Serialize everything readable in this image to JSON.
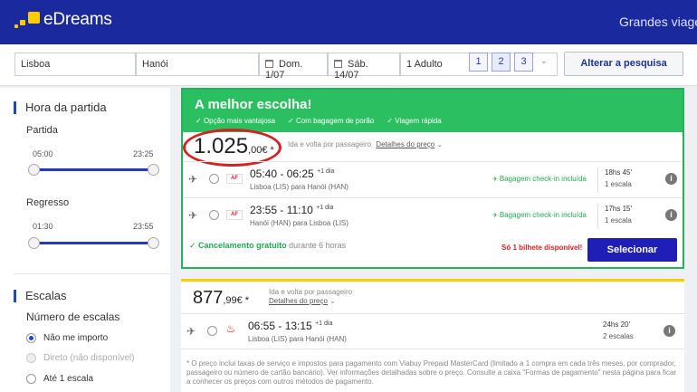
{
  "header": {
    "brand": "eDreams",
    "right_link": "Grandes viagens"
  },
  "search": {
    "origin": "Lisboa",
    "destination": "Hanói",
    "depart": "Dom. 1/07",
    "return": "Sáb. 14/07",
    "passengers": "1 Adulto",
    "pax_options": [
      "1",
      "2",
      "3"
    ],
    "update_label": "Alterar a pesquisa"
  },
  "sidebar": {
    "departure_time_title": "Hora da partida",
    "outbound_label": "Partida",
    "outbound_min": "05:00",
    "outbound_max": "23:25",
    "return_label": "Regresso",
    "return_min": "01:30",
    "return_max": "23:55",
    "stops_title": "Escalas",
    "stops_subtitle": "Número de escalas",
    "stop_options": [
      {
        "label": "Não me importo",
        "selected": true,
        "disabled": false
      },
      {
        "label": "Direto (não disponível)",
        "selected": false,
        "disabled": true
      },
      {
        "label": "Até 1 escala",
        "selected": false,
        "disabled": false
      }
    ]
  },
  "best": {
    "title": "A melhor escolha!",
    "features": [
      "Opção mais vantajosa",
      "Com bagagem de porão",
      "Viagem rápida"
    ],
    "price_main": "1.025",
    "price_decimal": ",00€",
    "price_star": "*",
    "per_pax": "Ida e volta por passageiro",
    "details_link": "Detalhes do preço",
    "legs": [
      {
        "airline": "AF",
        "times": "05:40 - 06:25",
        "day_offset": "+1 dia",
        "route": "Lisboa (LIS) para Hanói (HAN)",
        "baggage": "Bagagem check-in incluída",
        "duration": "18hs 45'",
        "stops": "1 escala"
      },
      {
        "airline": "AF",
        "times": "23:55 - 11:10",
        "day_offset": "+1 dia",
        "route": "Hanói (HAN) para Lisboa (LIS)",
        "baggage": "Bagagem check-in incluída",
        "duration": "17hs 15'",
        "stops": "1 escala"
      }
    ],
    "cancellation": "Cancelamento gratuito",
    "cancellation_note": "durante 6 horas",
    "availability": "Só 1 bilhete disponível!",
    "select_label": "Selecionar"
  },
  "second": {
    "price_main": "877",
    "price_decimal": ",99€",
    "price_star": "*",
    "per_pax": "Ida e volta por passageiro",
    "details_link": "Detalhes do preço",
    "leg": {
      "times": "06:55 - 13:15",
      "day_offset": "+1 dia",
      "route": "Lisboa (LIS) para Hanói (HAN)",
      "duration": "24hs 20'",
      "stops": "2 escalas"
    },
    "footnote": "* O preço inclui taxas de serviço e impostos para pagamento com Viabuy Prepaid MasterCard (limitado a 1 compra em cada três meses, por comprador, passageiro ou número de cartão bancário). Ver informações detalhadas sobre o preço. Consulte a caixa \"Formas de pagamento\" nesta página para ficar a conhecer os preços com outros métodos de pagamento."
  }
}
